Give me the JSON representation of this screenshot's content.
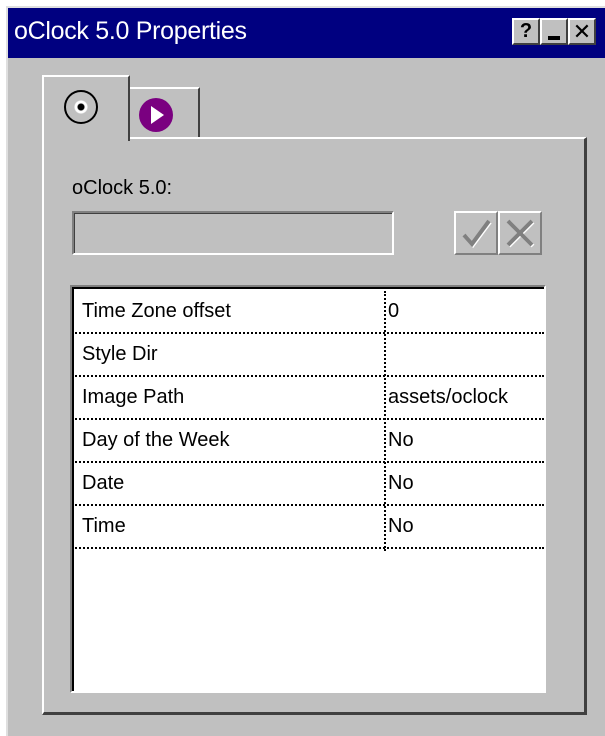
{
  "window": {
    "title": "oClock 5.0 Properties",
    "help_glyph": "?",
    "close_glyph": "✕"
  },
  "tabs": [
    {
      "icon": "cd-icon",
      "active": true
    },
    {
      "icon": "play-icon",
      "active": false
    }
  ],
  "panel": {
    "label": "oClock 5.0:",
    "name_value": "",
    "ok_icon": "checkmark-icon",
    "cancel_icon": "cross-icon"
  },
  "properties": [
    {
      "name": "Time Zone offset",
      "value": "0"
    },
    {
      "name": "Style Dir",
      "value": ""
    },
    {
      "name": "Image Path",
      "value": "assets/oclock"
    },
    {
      "name": "Day of the Week",
      "value": "No"
    },
    {
      "name": "Date",
      "value": "No"
    },
    {
      "name": "Time",
      "value": "No"
    }
  ],
  "colors": {
    "titlebar": "#000080",
    "face": "#c0c0c0",
    "play_icon": "#7a0080"
  }
}
